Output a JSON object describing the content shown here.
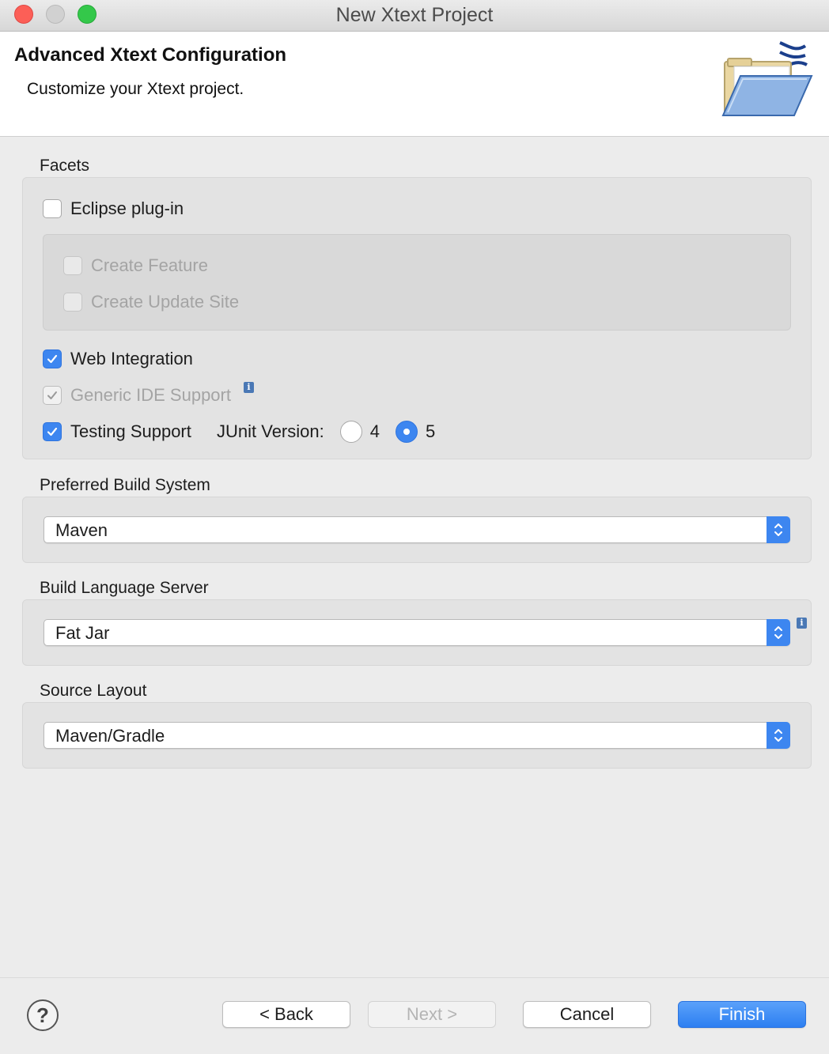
{
  "window": {
    "title": "New Xtext Project"
  },
  "header": {
    "title": "Advanced Xtext Configuration",
    "description": "Customize your Xtext project."
  },
  "facets": {
    "label": "Facets",
    "eclipse_plugin": {
      "label": "Eclipse plug-in",
      "checked": false
    },
    "create_feature": {
      "label": "Create Feature",
      "checked": false,
      "enabled": false
    },
    "create_update_site": {
      "label": "Create Update Site",
      "checked": false,
      "enabled": false
    },
    "web_integration": {
      "label": "Web Integration",
      "checked": true
    },
    "generic_ide_support": {
      "label": "Generic IDE Support",
      "checked": true,
      "enabled": false
    },
    "testing_support": {
      "label": "Testing Support",
      "checked": true
    },
    "junit": {
      "label": "JUnit Version:",
      "options": [
        "4",
        "5"
      ],
      "selected": "5"
    }
  },
  "build_system": {
    "label": "Preferred Build System",
    "value": "Maven"
  },
  "language_server": {
    "label": "Build Language Server",
    "value": "Fat Jar"
  },
  "source_layout": {
    "label": "Source Layout",
    "value": "Maven/Gradle"
  },
  "buttons": {
    "help": "?",
    "back": "< Back",
    "next": "Next >",
    "cancel": "Cancel",
    "finish": "Finish"
  },
  "icons": {
    "info": "info-icon",
    "help": "help-icon",
    "wizard": "folder-xtext-icon"
  },
  "colors": {
    "accent": "#3d86f0",
    "primary_button": "#2d7ff1"
  }
}
